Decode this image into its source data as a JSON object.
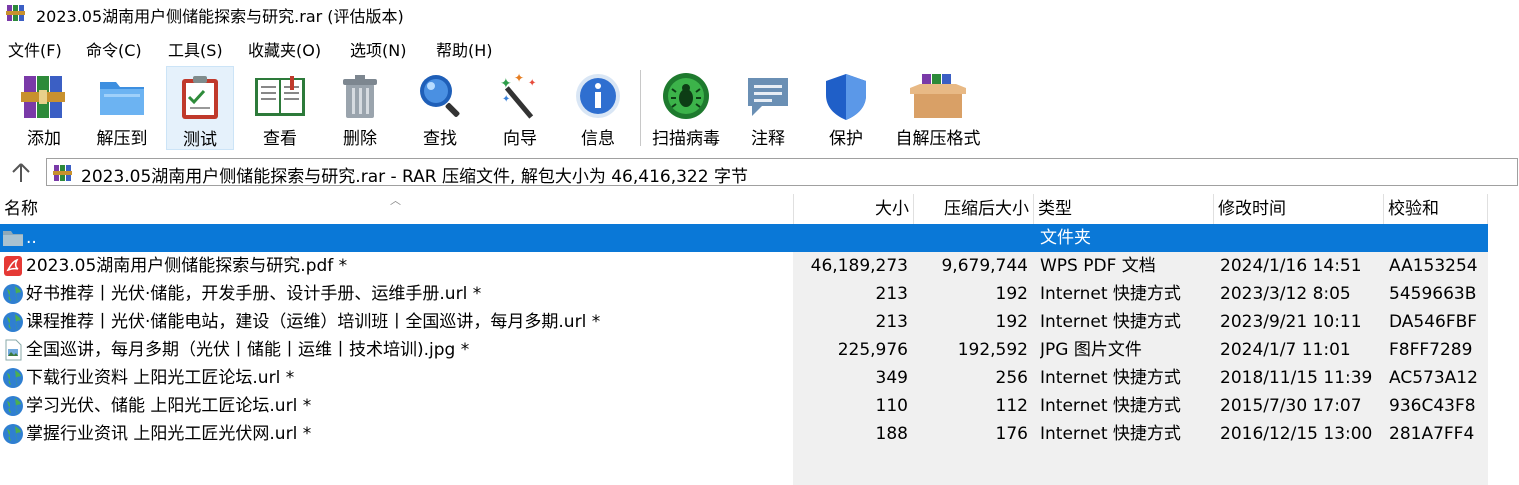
{
  "window": {
    "title": "2023.05湖南用户侧储能探索与研究.rar (评估版本)"
  },
  "menu": [
    "文件(F)",
    "命令(C)",
    "工具(S)",
    "收藏夹(O)",
    "选项(N)",
    "帮助(H)"
  ],
  "toolbar": {
    "add": "添加",
    "extract": "解压到",
    "test": "测试",
    "view": "查看",
    "delete": "删除",
    "find": "查找",
    "wizard": "向导",
    "info": "信息",
    "virus": "扫描病毒",
    "comment": "注释",
    "protect": "保护",
    "sfx": "自解压格式"
  },
  "address": {
    "text": "2023.05湖南用户侧储能探索与研究.rar - RAR 压缩文件, 解包大小为 46,416,322 字节"
  },
  "columns": {
    "name": "名称",
    "size": "大小",
    "packed": "压缩后大小",
    "type": "类型",
    "modified": "修改时间",
    "crc": "校验和"
  },
  "files": [
    {
      "name": "..",
      "size": "",
      "packed": "",
      "type": "文件夹",
      "modified": "",
      "crc": "",
      "icon": "folder-icon"
    },
    {
      "name": "2023.05湖南用户侧储能探索与研究.pdf *",
      "size": "46,189,273",
      "packed": "9,679,744",
      "type": "WPS PDF 文档",
      "modified": "2024/1/16 14:51",
      "crc": "AA153254",
      "icon": "pdf-icon"
    },
    {
      "name": "好书推荐丨光伏·储能，开发手册、设计手册、运维手册.url *",
      "size": "213",
      "packed": "192",
      "type": "Internet 快捷方式",
      "modified": "2023/3/12 8:05",
      "crc": "5459663B",
      "icon": "globe-icon"
    },
    {
      "name": "课程推荐丨光伏·储能电站，建设（运维）培训班丨全国巡讲，每月多期.url *",
      "size": "213",
      "packed": "192",
      "type": "Internet 快捷方式",
      "modified": "2023/9/21 10:11",
      "crc": "DA546FBF",
      "icon": "globe-icon"
    },
    {
      "name": "全国巡讲，每月多期（光伏丨储能丨运维丨技术培训).jpg *",
      "size": "225,976",
      "packed": "192,592",
      "type": "JPG 图片文件",
      "modified": "2024/1/7 11:01",
      "crc": "F8FF7289",
      "icon": "image-file-icon"
    },
    {
      "name": "下载行业资料 上阳光工匠论坛.url *",
      "size": "349",
      "packed": "256",
      "type": "Internet 快捷方式",
      "modified": "2018/11/15 11:39",
      "crc": "AC573A12",
      "icon": "globe-icon"
    },
    {
      "name": "学习光伏、储能 上阳光工匠论坛.url *",
      "size": "110",
      "packed": "112",
      "type": "Internet 快捷方式",
      "modified": "2015/7/30 17:07",
      "crc": "936C43F8",
      "icon": "globe-icon"
    },
    {
      "name": "掌握行业资讯 上阳光工匠光伏网.url *",
      "size": "188",
      "packed": "176",
      "type": "Internet 快捷方式",
      "modified": "2016/12/15 13:00",
      "crc": "281A7FF4",
      "icon": "globe-icon"
    }
  ],
  "colors": {
    "selection": "#0a78d7",
    "accent": "#1a6fc4"
  }
}
